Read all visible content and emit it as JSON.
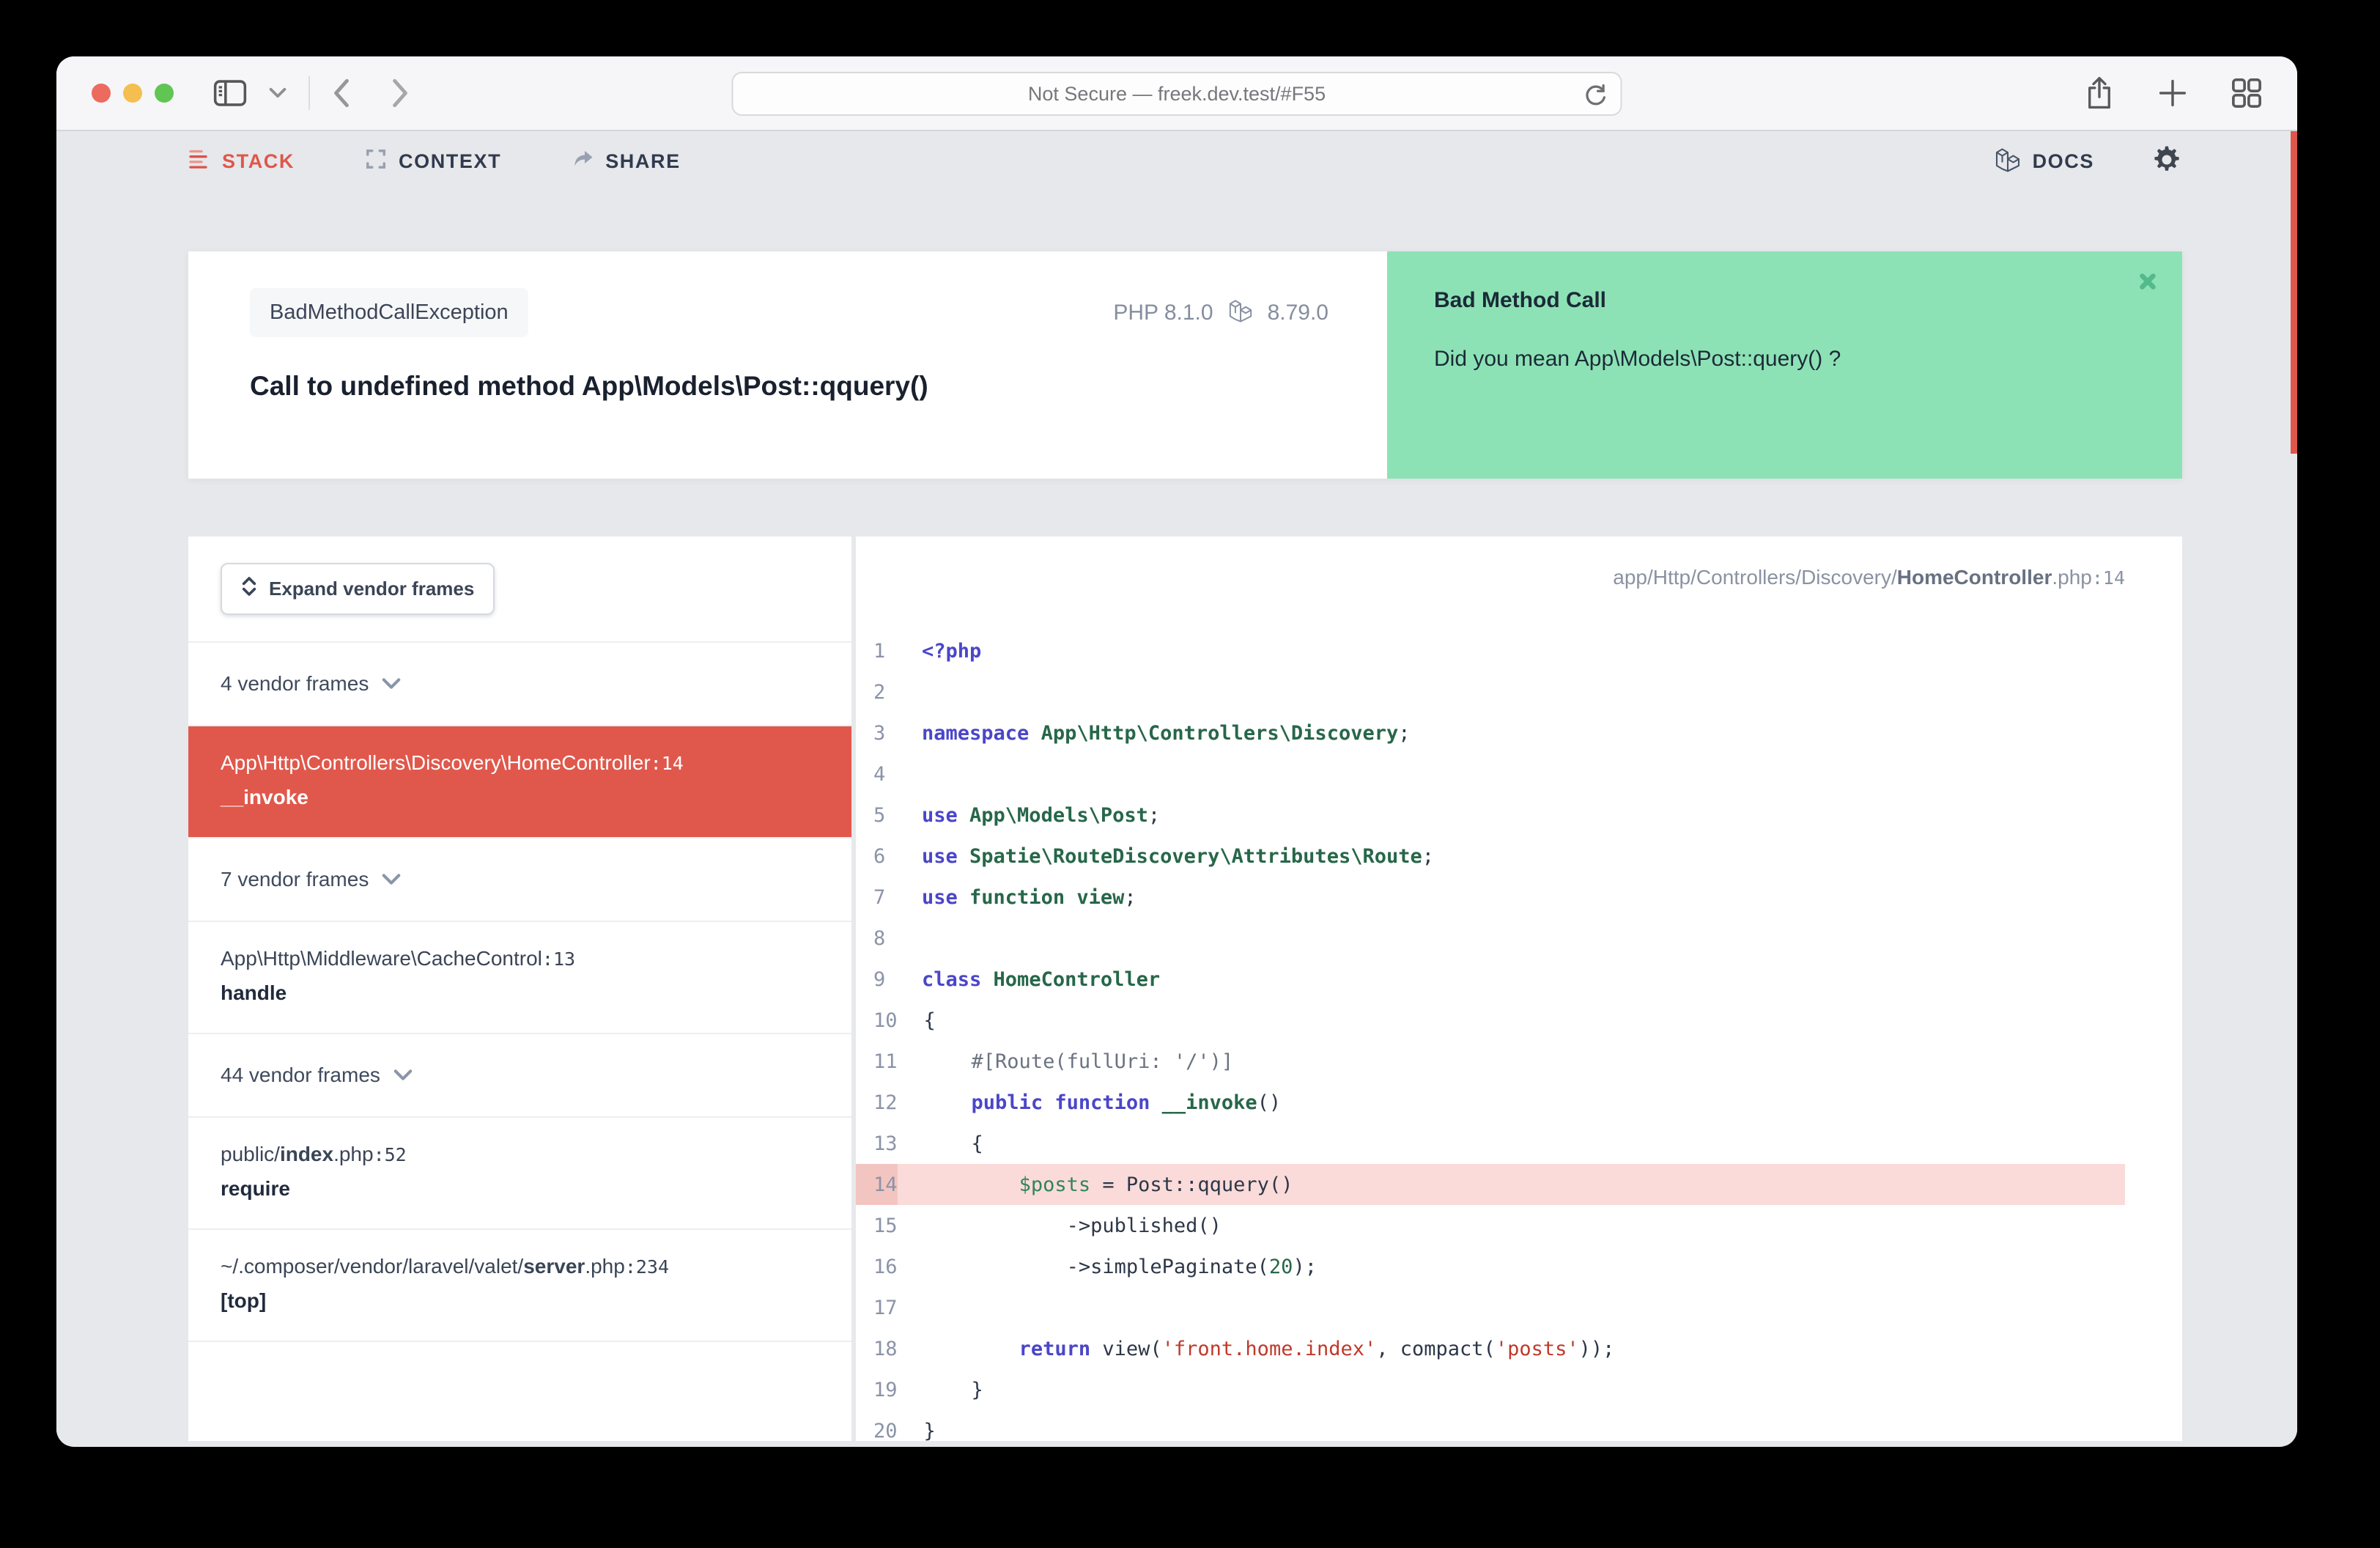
{
  "browser": {
    "url": "Not Secure — freek.dev.test/#F55"
  },
  "nav": {
    "stack": "STACK",
    "context": "CONTEXT",
    "share": "SHARE",
    "docs": "DOCS"
  },
  "error": {
    "exception_class": "BadMethodCallException",
    "message": "Call to undefined method App\\Models\\Post::qquery()",
    "php_version": "PHP 8.1.0",
    "laravel_version": "8.79.0"
  },
  "solution": {
    "title": "Bad Method Call",
    "body": "Did you mean App\\Models\\Post::query() ?"
  },
  "stack": {
    "expand_button": "Expand vendor frames",
    "items": [
      {
        "kind": "collapse",
        "label": "4 vendor frames"
      },
      {
        "kind": "frame",
        "active": true,
        "path": [
          [
            "",
            "App\\Http\\Controllers\\Discovery\\HomeController"
          ],
          [
            "num",
            ":14"
          ]
        ],
        "method": "__invoke"
      },
      {
        "kind": "collapse",
        "label": "7 vendor frames"
      },
      {
        "kind": "frame",
        "path": [
          [
            "",
            "App\\Http\\Middleware\\CacheControl"
          ],
          [
            "num",
            ":13"
          ]
        ],
        "method": "handle"
      },
      {
        "kind": "collapse",
        "label": "44 vendor frames"
      },
      {
        "kind": "frame",
        "path": [
          [
            "",
            "public/"
          ],
          [
            "b",
            "index"
          ],
          [
            "",
            ".php"
          ],
          [
            "num",
            ":52"
          ]
        ],
        "method": "require"
      },
      {
        "kind": "frame",
        "path": [
          [
            "",
            "~/.composer/vendor/laravel/valet/"
          ],
          [
            "b",
            "server"
          ],
          [
            "",
            ".php"
          ],
          [
            "num",
            ":234"
          ]
        ],
        "method": "[top]"
      }
    ]
  },
  "code": {
    "file_path": [
      [
        "",
        "app/Http/Controllers/Discovery/"
      ],
      [
        "b",
        "HomeController"
      ],
      [
        "",
        ".php"
      ],
      [
        "num",
        ":14"
      ]
    ],
    "highlight_line": 14,
    "lines": [
      {
        "n": 1,
        "tokens": [
          [
            "k",
            "<?php"
          ]
        ]
      },
      {
        "n": 2,
        "tokens": []
      },
      {
        "n": 3,
        "tokens": [
          [
            "k",
            "namespace "
          ],
          [
            "t",
            "App\\Http\\Controllers\\Discovery"
          ],
          [
            "p",
            ";"
          ]
        ]
      },
      {
        "n": 4,
        "tokens": []
      },
      {
        "n": 5,
        "tokens": [
          [
            "k",
            "use "
          ],
          [
            "t",
            "App\\Models\\Post"
          ],
          [
            "p",
            ";"
          ]
        ]
      },
      {
        "n": 6,
        "tokens": [
          [
            "k",
            "use "
          ],
          [
            "t",
            "Spatie\\RouteDiscovery\\Attributes\\Route"
          ],
          [
            "p",
            ";"
          ]
        ]
      },
      {
        "n": 7,
        "tokens": [
          [
            "k",
            "use "
          ],
          [
            "t",
            "function view"
          ],
          [
            "p",
            ";"
          ]
        ]
      },
      {
        "n": 8,
        "tokens": []
      },
      {
        "n": 9,
        "tokens": [
          [
            "k",
            "class "
          ],
          [
            "t",
            "HomeController"
          ]
        ]
      },
      {
        "n": 10,
        "tokens": [
          [
            "p",
            "{"
          ]
        ]
      },
      {
        "n": 11,
        "tokens": [
          [
            "c",
            "    #[Route(fullUri: '/')]"
          ]
        ]
      },
      {
        "n": 12,
        "tokens": [
          [
            "k",
            "    public function "
          ],
          [
            "t",
            "__invoke"
          ],
          [
            "p",
            "()"
          ]
        ]
      },
      {
        "n": 13,
        "tokens": [
          [
            "p",
            "    {"
          ]
        ]
      },
      {
        "n": 14,
        "tokens": [
          [
            "p",
            "        "
          ],
          [
            "v",
            "$posts"
          ],
          [
            "p",
            " = Post::qquery()"
          ]
        ]
      },
      {
        "n": 15,
        "tokens": [
          [
            "p",
            "            ->published()"
          ]
        ]
      },
      {
        "n": 16,
        "tokens": [
          [
            "p",
            "            ->simplePaginate("
          ],
          [
            "n",
            "20"
          ],
          [
            "p",
            ");"
          ]
        ]
      },
      {
        "n": 17,
        "tokens": []
      },
      {
        "n": 18,
        "tokens": [
          [
            "k",
            "        return "
          ],
          [
            "p",
            "view("
          ],
          [
            "s",
            "'front.home.index'"
          ],
          [
            "p",
            ", compact("
          ],
          [
            "s",
            "'posts'"
          ],
          [
            "p",
            "));"
          ]
        ]
      },
      {
        "n": 19,
        "tokens": [
          [
            "p",
            "    }"
          ]
        ]
      },
      {
        "n": 20,
        "tokens": [
          [
            "p",
            "}"
          ]
        ]
      }
    ]
  },
  "colors": {
    "accent-red": "#df574b",
    "frame-red": "#e0584c",
    "solution-green": "#8de2b5",
    "solution-close": "#53ba8b",
    "highlight-pink": "#fadbd9",
    "highlight-pink-dark": "#f3c5c1",
    "code-keyword": "#4b46c9",
    "code-type": "#276749",
    "code-variable": "#2f855a",
    "code-string": "#c0392b",
    "code-plain": "#2d3748",
    "code-comment": "#6b7280",
    "traffic-red": "#ed6a5e",
    "traffic-yellow": "#f5bf4f",
    "traffic-green": "#61c554"
  }
}
